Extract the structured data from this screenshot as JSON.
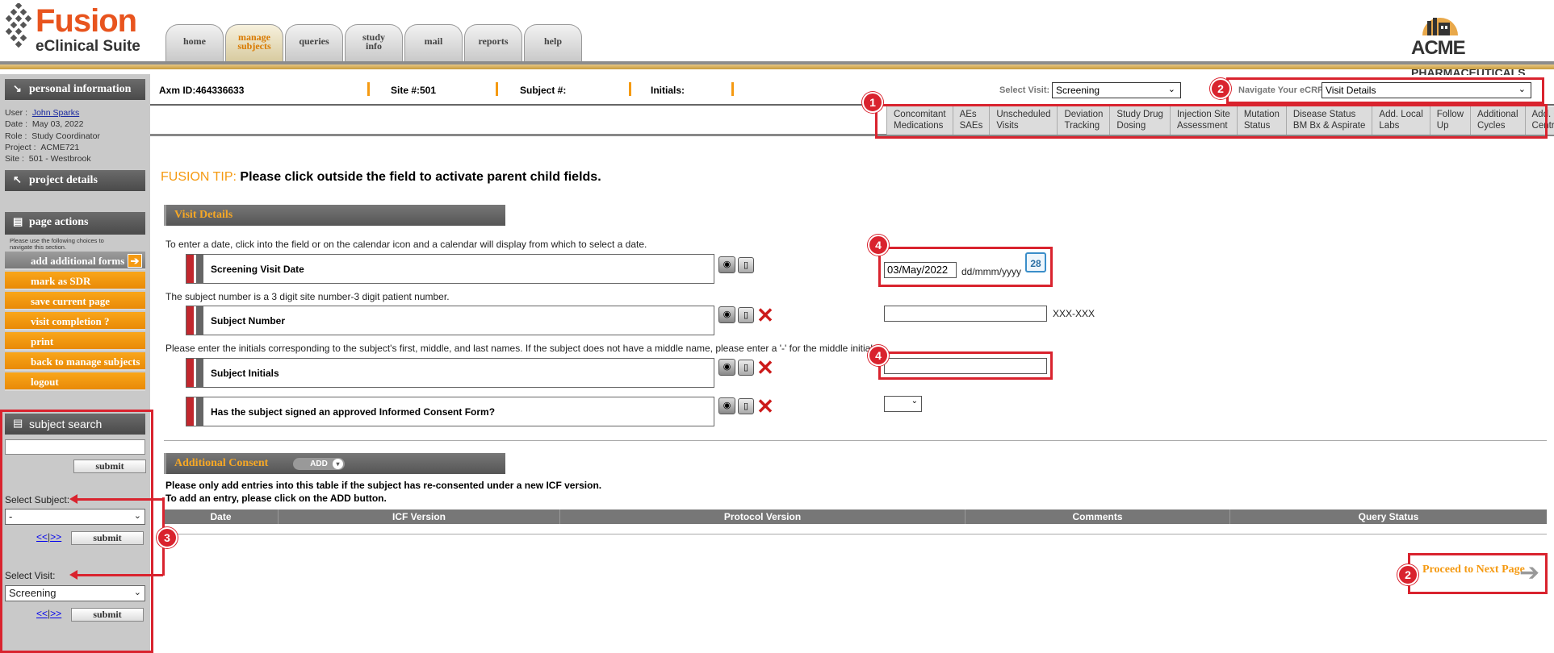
{
  "header": {
    "brand_name": "Fusion",
    "brand_subtitle": "eClinical Suite",
    "partner_logo": "ACME",
    "partner_logo_suffix": "PHARMACEUTICALS",
    "tabs": [
      {
        "label": "home"
      },
      {
        "label": "manage subjects",
        "active": true
      },
      {
        "label": "queries"
      },
      {
        "label": "study info"
      },
      {
        "label": "mail"
      },
      {
        "label": "reports"
      },
      {
        "label": "help"
      }
    ]
  },
  "sidebar": {
    "personal_information": {
      "heading": "personal information",
      "user_label": "User",
      "user_value": "John Sparks",
      "date_label": "Date",
      "date_value": "May 03, 2022",
      "role_label": "Role",
      "role_value": "Study Coordinator",
      "project_label": "Project",
      "project_value": "ACME721",
      "site_label": "Site",
      "site_value": "501 - Westbrook"
    },
    "project_details": {
      "heading": "project details"
    },
    "page_actions": {
      "heading": "page actions",
      "note": "Please use the following choices to navigate this section.",
      "items": [
        {
          "label": "add additional forms"
        },
        {
          "label": "mark as SDR"
        },
        {
          "label": "save current page"
        },
        {
          "label": "visit completion ?"
        },
        {
          "label": "print"
        },
        {
          "label": "back to manage subjects"
        },
        {
          "label": "logout"
        }
      ]
    },
    "subject_search": {
      "heading": "subject search",
      "submit_label": "submit",
      "select_subject_label": "Select Subject:",
      "select_subject_value": "-",
      "select_visit_label": "Select Visit:",
      "select_visit_value": "Screening",
      "nav_prev": "<<",
      "nav_sep": "|",
      "nav_next": ">>"
    }
  },
  "infobar": {
    "axm_id": "Axm ID:464336633",
    "site": "Site #:501",
    "subject": "Subject #:",
    "initials": "Initials:",
    "select_visit_label": "Select Visit:",
    "select_visit_value": "Screening",
    "navigate_label": "Navigate Your eCRF:",
    "navigate_value": "Visit Details"
  },
  "nav_tabs": [
    {
      "line1": "Concomitant",
      "line2": "Medications"
    },
    {
      "line1": "AEs",
      "line2": "SAEs"
    },
    {
      "line1": "Unscheduled",
      "line2": "Visits"
    },
    {
      "line1": "Deviation",
      "line2": "Tracking"
    },
    {
      "line1": "Study Drug",
      "line2": "Dosing"
    },
    {
      "line1": "Injection Site",
      "line2": "Assessment"
    },
    {
      "line1": "Mutation",
      "line2": "Status"
    },
    {
      "line1": "Disease Status",
      "line2": "BM Bx & Aspirate"
    },
    {
      "line1": "Add. Local",
      "line2": "Labs"
    },
    {
      "line1": "Follow",
      "line2": "Up"
    },
    {
      "line1": "Additional",
      "line2": "Cycles"
    },
    {
      "line1": "Add. Cycles",
      "line2": "Central Labs"
    }
  ],
  "main": {
    "tip_label": "FUSION TIP:",
    "tip_text": "Please click outside the field to activate parent child fields.",
    "visit_details": {
      "heading": "Visit Details",
      "date_help": "To enter a date, click into the field or on the calendar icon and a calendar will display from which to select a date.",
      "screening_visit_date_label": "Screening Visit Date",
      "screening_visit_date_value": "03/May/2022",
      "date_format": "dd/mmm/yyyy",
      "calendar_day": "28",
      "subject_help": "The subject number is a 3 digit site number-3 digit patient number.",
      "subject_number_label": "Subject Number",
      "subject_number_value": "",
      "subject_number_format": "XXX-XXX",
      "initials_help": "Please enter the initials corresponding to the subject's first, middle, and last names. If the subject does not have a middle name, please enter a '-' for the middle initial.",
      "subject_initials_label": "Subject Initials",
      "subject_initials_value": "",
      "consent_label": "Has the subject signed an approved Informed Consent Form?",
      "consent_value": ""
    },
    "additional_consent": {
      "heading": "Additional Consent",
      "add_label": "ADD",
      "note1": "Please only add entries into this table if the subject has re-consented under a new ICF version.",
      "note2": "To add an entry, please click on the ADD button.",
      "columns": [
        "Date",
        "ICF Version",
        "Protocol Version",
        "Comments",
        "Query Status"
      ]
    },
    "proceed_label": "Proceed to Next Page"
  },
  "annotations": {
    "badge_1": "1",
    "badge_2": "2",
    "badge_3": "3",
    "badge_4": "4",
    "color": "#d9232e"
  }
}
